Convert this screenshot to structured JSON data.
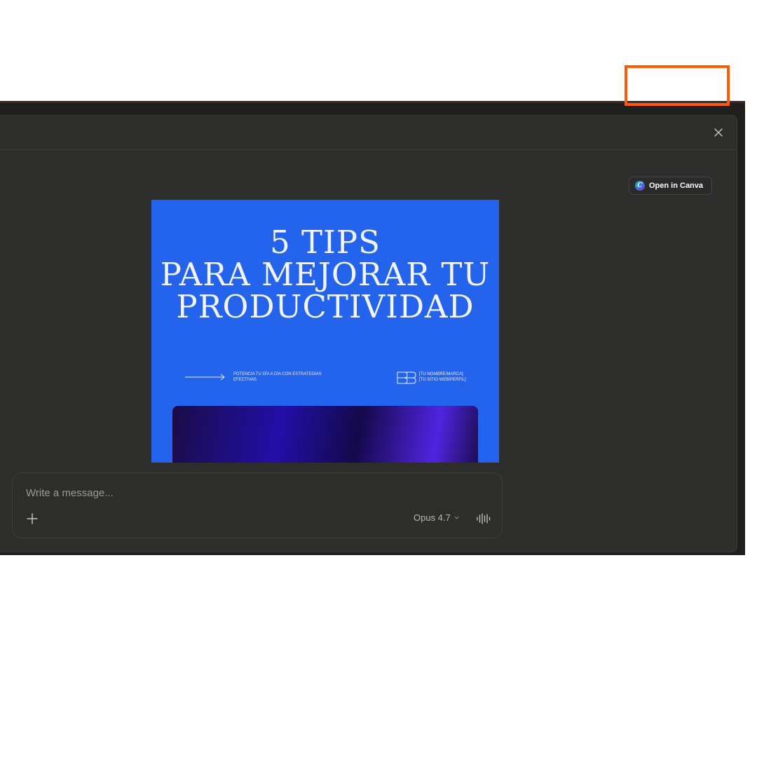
{
  "header": {
    "close_icon": "close-icon"
  },
  "canva_button": {
    "label": "Open in Canva",
    "icon": "canva-logo-icon",
    "highlight_color": "#ff5a0a"
  },
  "preview": {
    "background_color": "#2463eb",
    "title_lines": [
      "5 TIPS",
      "PARA MEJORAR TU",
      "PRODUCTIVIDAD"
    ],
    "tagline_lines": [
      "POTENCIA TU DÍA A DÍA CON ESTRATEGIAS",
      "EFECTIVAS"
    ],
    "brand_lines": [
      "[TU NOMBRE/MARCA]",
      "[TU SITIO WEB/PERFIL]"
    ]
  },
  "composer": {
    "placeholder": "Write a message...",
    "model": "Opus 4.7",
    "add_icon": "plus-icon",
    "voice_icon": "voice-waveform-icon"
  }
}
